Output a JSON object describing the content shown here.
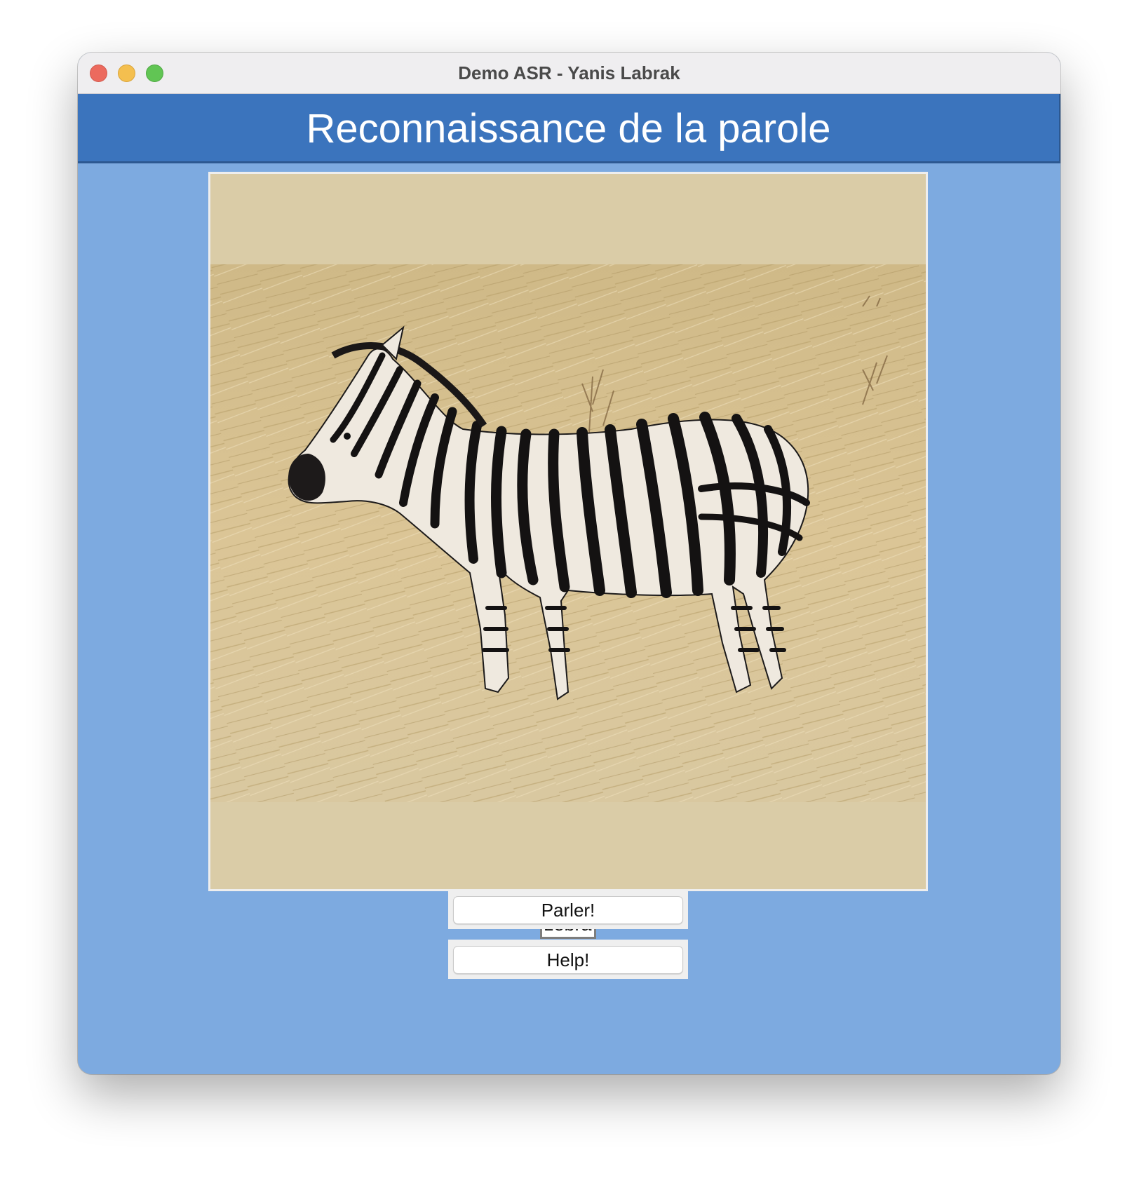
{
  "window": {
    "title": "Demo ASR - Yanis Labrak"
  },
  "header": {
    "title": "Reconnaissance de la parole"
  },
  "image": {
    "subject": "zebra-photo"
  },
  "recognized": {
    "value": "zebra"
  },
  "buttons": {
    "speak_label": "Parler!",
    "help_label": "Help!"
  },
  "colors": {
    "window_background": "#7daae0",
    "header_background": "#3b74bd",
    "image_letterbox": "#dacca7"
  }
}
